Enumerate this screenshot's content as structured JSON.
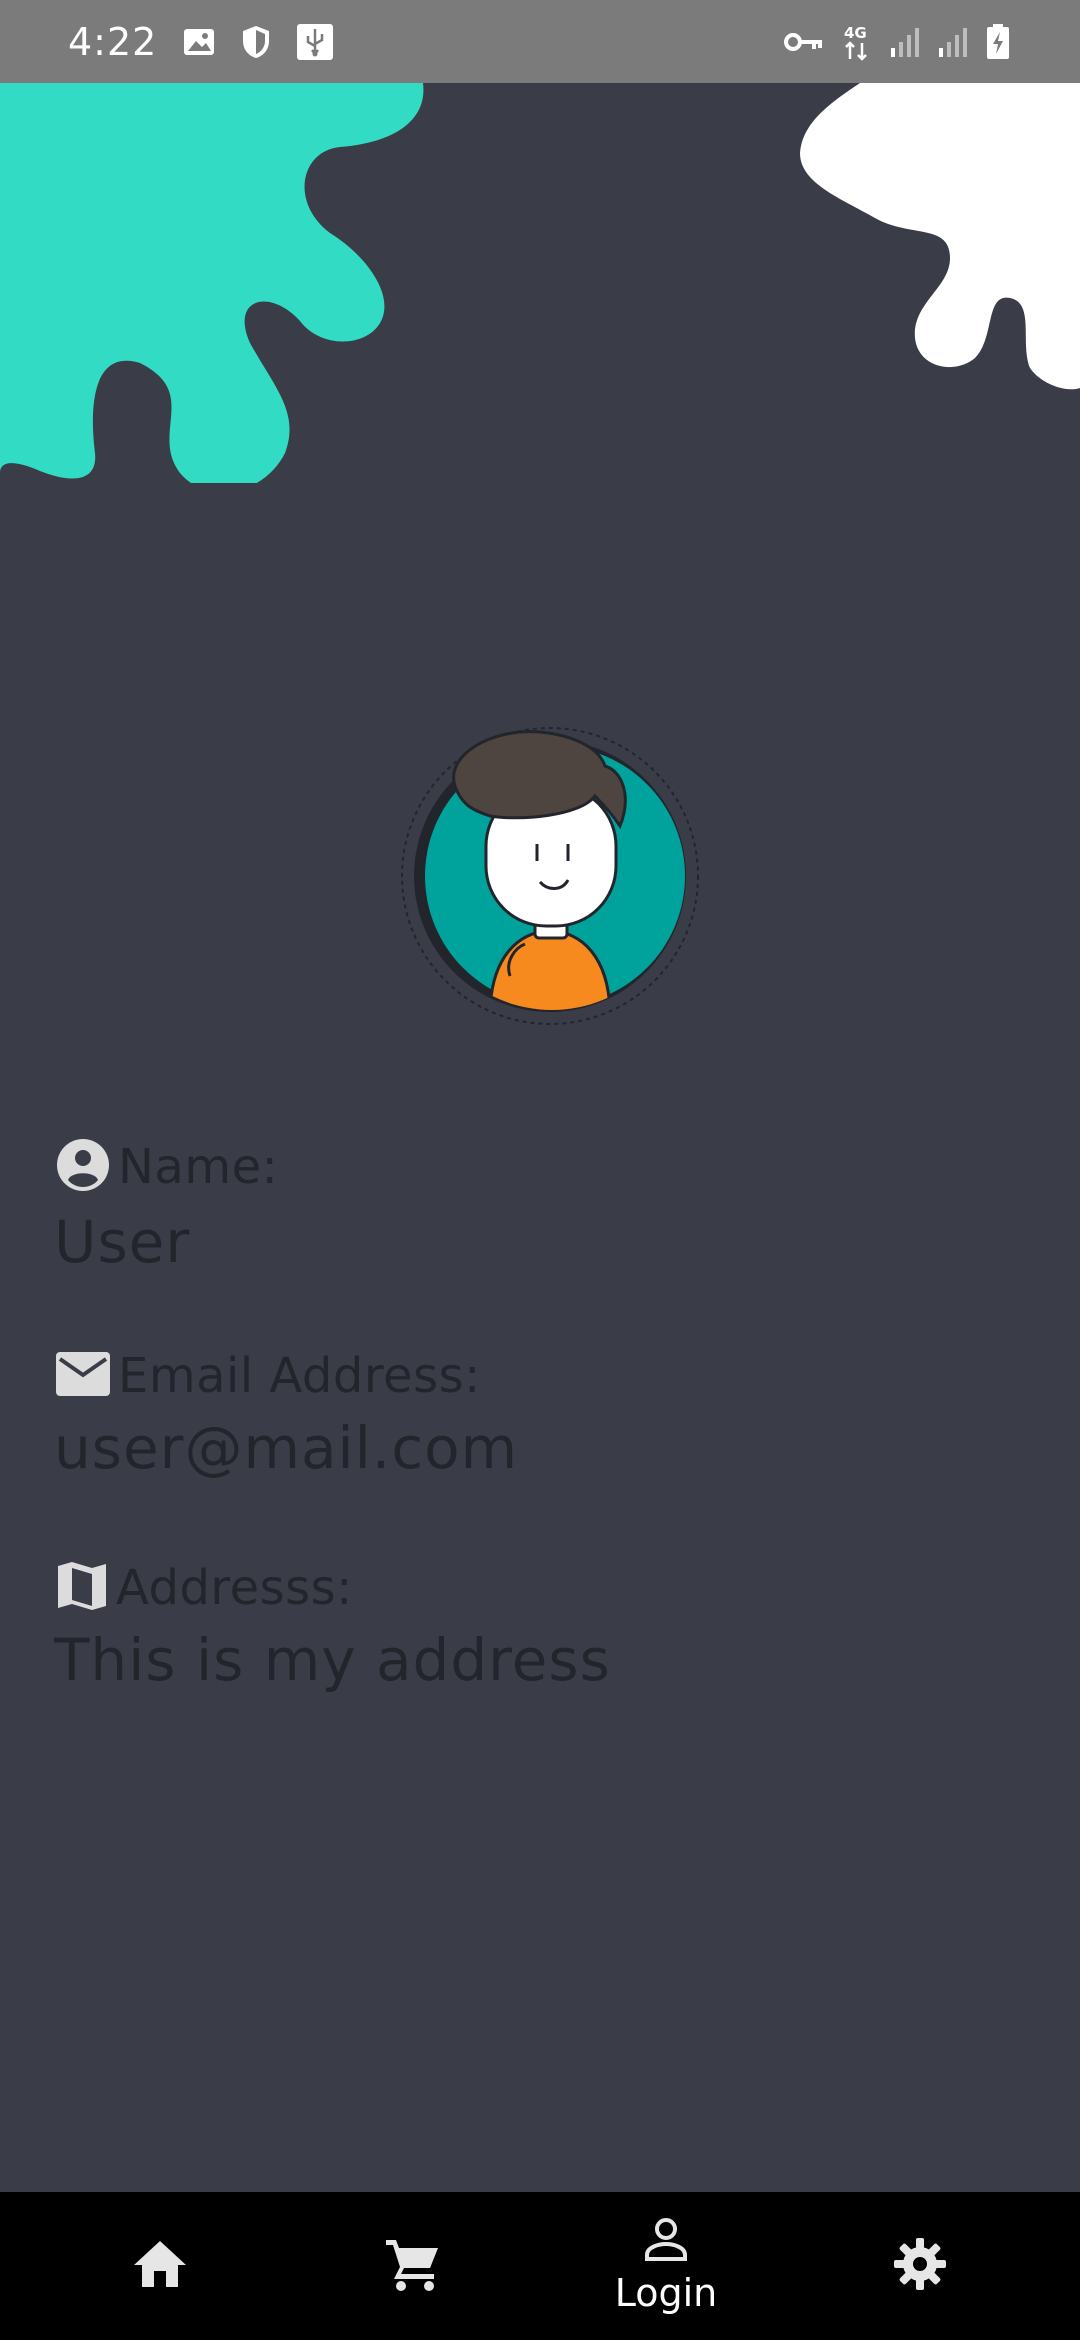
{
  "status_bar": {
    "time": "4:22",
    "left_icons": [
      "image-icon",
      "shield-icon",
      "usb-icon"
    ],
    "right_icons": [
      "key-icon",
      "network-4g-icon",
      "signal-icon",
      "signal-icon",
      "battery-charging-icon"
    ],
    "network_label": "4G"
  },
  "colors": {
    "background": "#3a3d47",
    "splash_left": "#32dcc4",
    "splash_right": "#ffffff",
    "avatar_ring": "#00a39b",
    "avatar_shirt": "#f68a1f",
    "avatar_hair": "#4e4541",
    "text": "#23252c",
    "nav_background": "#000000"
  },
  "profile": {
    "name_label": "Name:",
    "name_value": "User",
    "email_label": "Email Address:",
    "email_value": "user@mail.com",
    "address_label": "Addresss:",
    "address_value": "This is my address"
  },
  "bottom_nav": {
    "items": [
      {
        "icon": "home-icon",
        "label": ""
      },
      {
        "icon": "cart-icon",
        "label": ""
      },
      {
        "icon": "person-icon",
        "label": "Login"
      },
      {
        "icon": "gear-icon",
        "label": ""
      }
    ]
  }
}
